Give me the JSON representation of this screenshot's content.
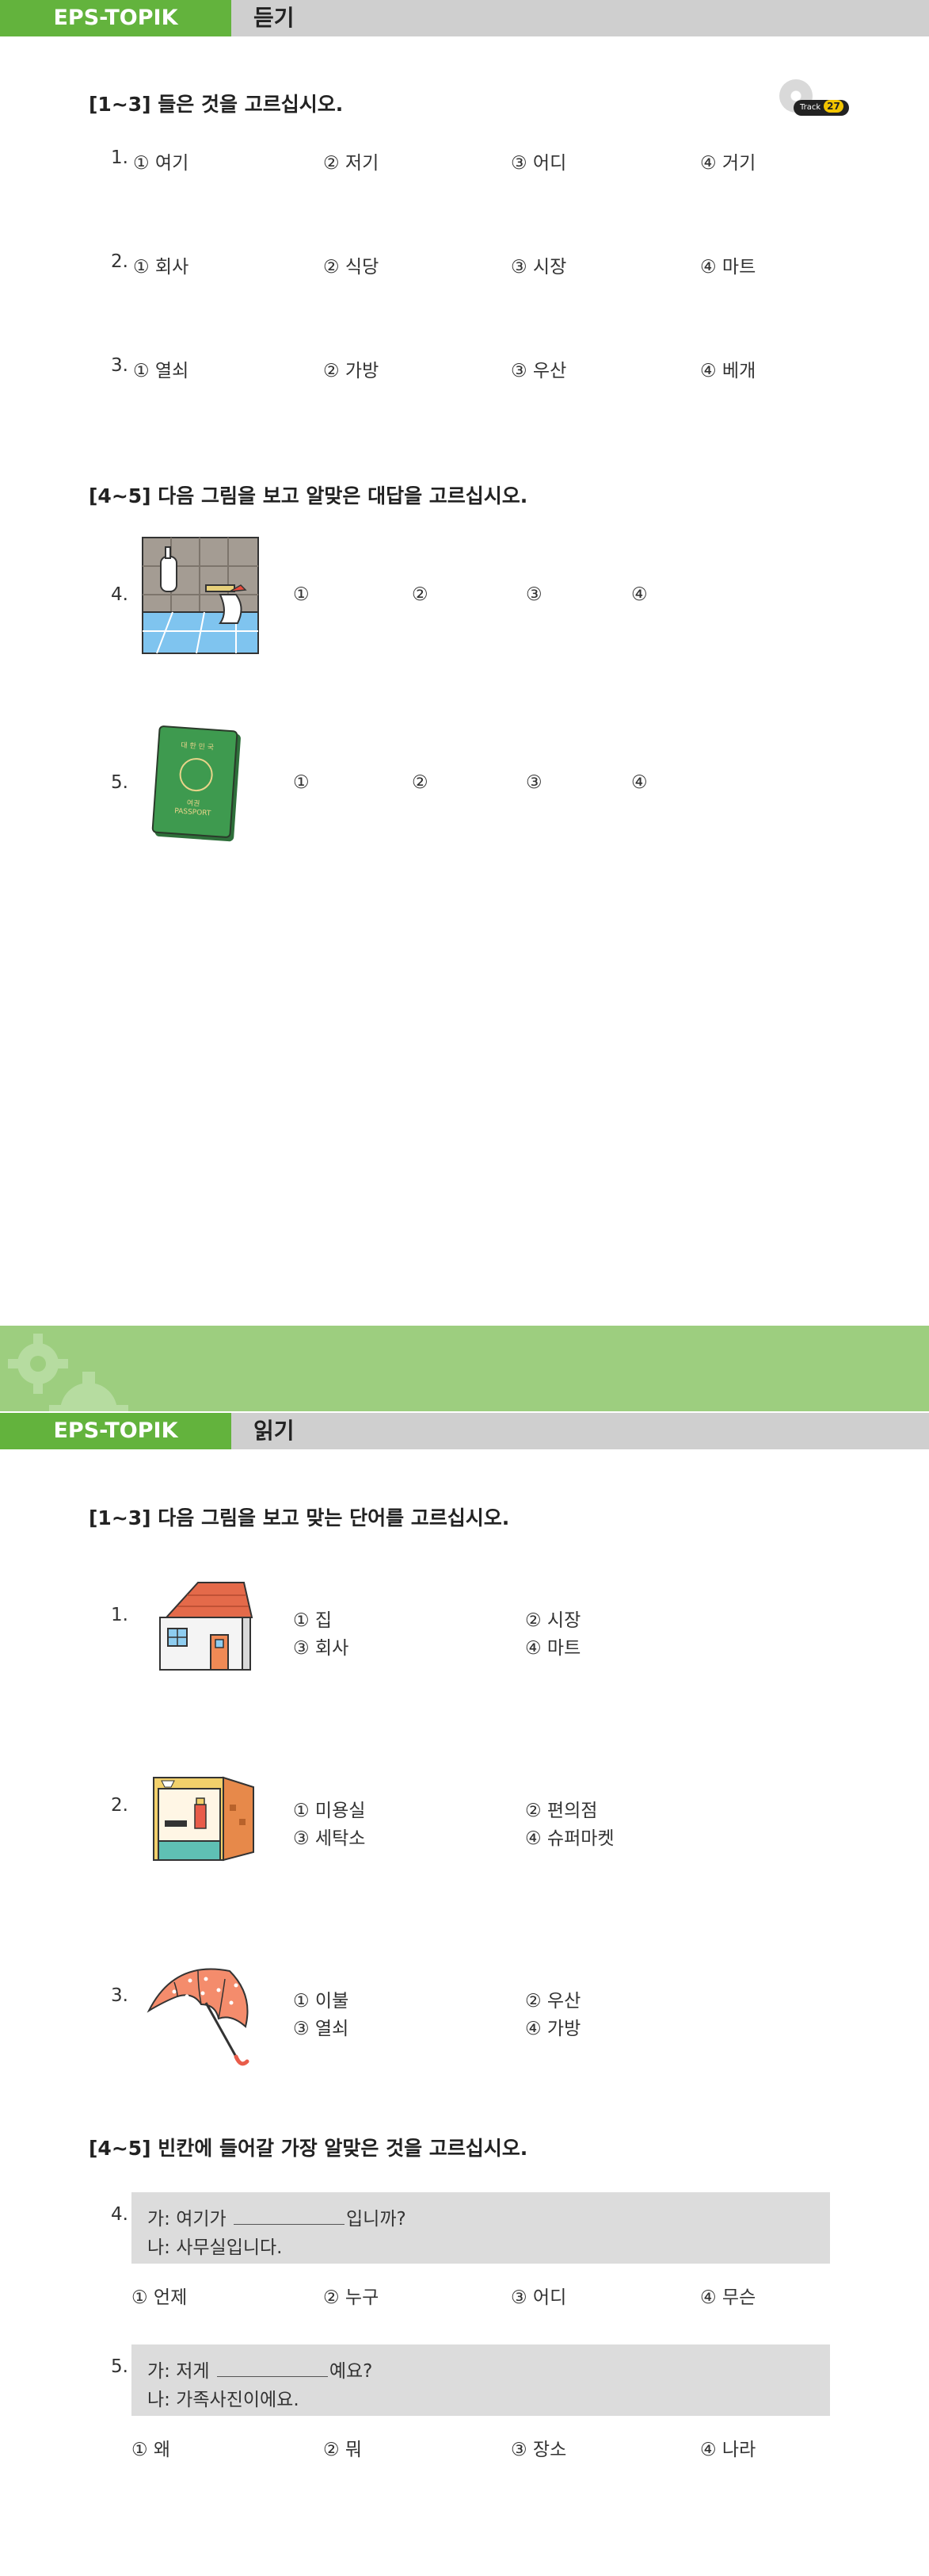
{
  "listening": {
    "header_brand": "EPS-TOPIK",
    "header_section": "듣기",
    "track_label": "Track",
    "track_number": "27",
    "part1_title": "[1~3] 들은 것을 고르십시오.",
    "part1_questions": [
      {
        "num": "1.",
        "options": [
          "① 여기",
          "② 저기",
          "③ 어디",
          "④  거기"
        ]
      },
      {
        "num": "2.",
        "options": [
          "① 회사",
          "② 식당",
          "③ 시장",
          "④ 마트"
        ]
      },
      {
        "num": "3.",
        "options": [
          "① 열쇠",
          "② 가방",
          "③ 우산",
          "④ 베개"
        ]
      }
    ],
    "part2_title": "[4~5] 다음 그림을 보고 알맞은 대답을 고르십시오.",
    "part2_questions": [
      {
        "num": "4.",
        "options": [
          "①",
          "②",
          "③",
          "④"
        ]
      },
      {
        "num": "5.",
        "options": [
          "①",
          "②",
          "③",
          "④"
        ]
      }
    ],
    "passport_text_top": "대 한 민 국",
    "passport_text_mid": "여권",
    "passport_text_bottom": "PASSPORT"
  },
  "reading": {
    "header_brand": "EPS-TOPIK",
    "header_section": "읽기",
    "part1_title": "[1~3] 다음 그림을 보고 맞는 단어를 고르십시오.",
    "part1_questions": [
      {
        "num": "1.",
        "options": [
          "① 집",
          "② 시장",
          "③ 회사",
          "④ 마트"
        ]
      },
      {
        "num": "2.",
        "options": [
          "① 미용실",
          "② 편의점",
          "③ 세탁소",
          "④ 슈퍼마켓"
        ]
      },
      {
        "num": "3.",
        "options": [
          "① 이불",
          "② 우산",
          "③ 열쇠",
          "④ 가방"
        ]
      }
    ],
    "part2_title": "[4~5] 빈칸에 들어갈 가장 알맞은 것을 고르십시오.",
    "part2_questions": [
      {
        "num": "4.",
        "line1_prefix": "가: 여기가",
        "line1_suffix": "입니까?",
        "line2": "나: 사무실입니다.",
        "options": [
          "① 언제",
          "② 누구",
          "③ 어디",
          "④ 무슨"
        ]
      },
      {
        "num": "5.",
        "line1_prefix": "가: 저게",
        "line1_suffix": "예요?",
        "line2": "나: 가족사진이에요.",
        "options": [
          "① 왜",
          "② 뭐",
          "③ 장소",
          "④ 나라"
        ]
      }
    ]
  },
  "colors": {
    "green": "#63b33d",
    "banner_green": "#9dce7f",
    "header_gray": "#cfcfcf",
    "dialog_gray": "#dcdcdc"
  }
}
